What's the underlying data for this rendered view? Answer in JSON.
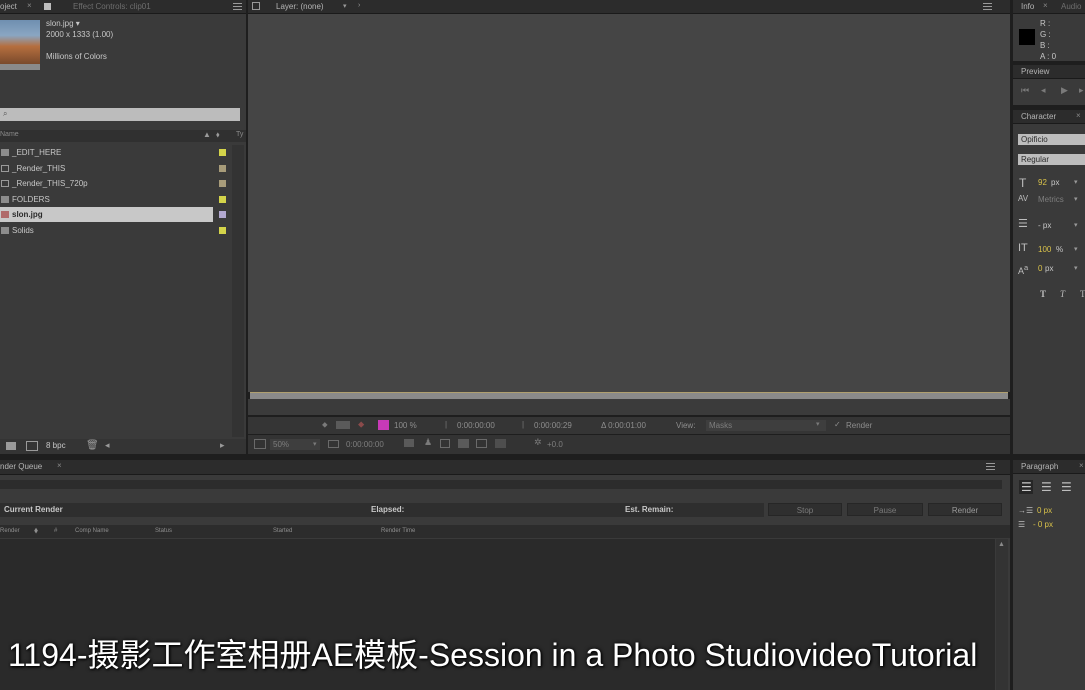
{
  "project": {
    "tab_label": "oject",
    "effect_controls_tab": "Effect Controls: clip01",
    "file_name": "slon.jpg ▾",
    "dimensions": "2000 x 1333 (1.00)",
    "colors": "Millions of Colors",
    "search_placeholder": "⌕",
    "col_name": "Name",
    "col_type": "Ty",
    "items": [
      {
        "label": "_EDIT_HERE",
        "color": "#d4d44a"
      },
      {
        "label": "_Render_THIS",
        "color": "#a89c7a"
      },
      {
        "label": "_Render_THIS_720p",
        "color": "#a89c7a"
      },
      {
        "label": "FOLDERS",
        "color": "#d4d44a"
      },
      {
        "label": "slon.jpg",
        "color": "#b2a8d0"
      },
      {
        "label": "Solids",
        "color": "#d4d44a"
      }
    ],
    "bpc": "8 bpc"
  },
  "layer": {
    "tab_label": "Layer: (none)",
    "zoom_pct": "100 %",
    "time_start": "0:00:00:00",
    "time_end": "0:00:00:29",
    "duration": "Δ 0:00:01:00",
    "view_label": "View:",
    "view_value": "Masks",
    "render_label": "Render",
    "mag": "50%",
    "time_current": "0:00:00:00",
    "offset": "+0.0"
  },
  "info": {
    "tab_label": "Info",
    "audio_tab": "Audio",
    "r": "R :",
    "g": "G :",
    "b": "B :",
    "a": "A : 0"
  },
  "preview": {
    "tab_label": "Preview"
  },
  "character": {
    "tab_label": "Character",
    "font": "Opificio",
    "style": "Regular",
    "size": "92",
    "size_unit": "px",
    "kerning": "Metrics",
    "leading": "- px",
    "vscale": "100",
    "vscale_unit": "%",
    "baseline": "0",
    "baseline_unit": "px",
    "faux_bold": "T",
    "faux_italic": "T",
    "caps": "T"
  },
  "render_queue": {
    "tab_label": "nder Queue",
    "current_render": "Current Render",
    "elapsed": "Elapsed:",
    "est_remain": "Est. Remain:",
    "stop": "Stop",
    "pause": "Pause",
    "render": "Render",
    "columns": [
      "Render",
      "#",
      "Comp Name",
      "Status",
      "Started",
      "Render Time"
    ]
  },
  "paragraph": {
    "tab_label": "Paragraph",
    "indent_left": "0 px",
    "indent_first": "- 0 px"
  },
  "caption": "1194-摄影工作室相册AE模板-Session in a Photo StudiovideoTutorial"
}
